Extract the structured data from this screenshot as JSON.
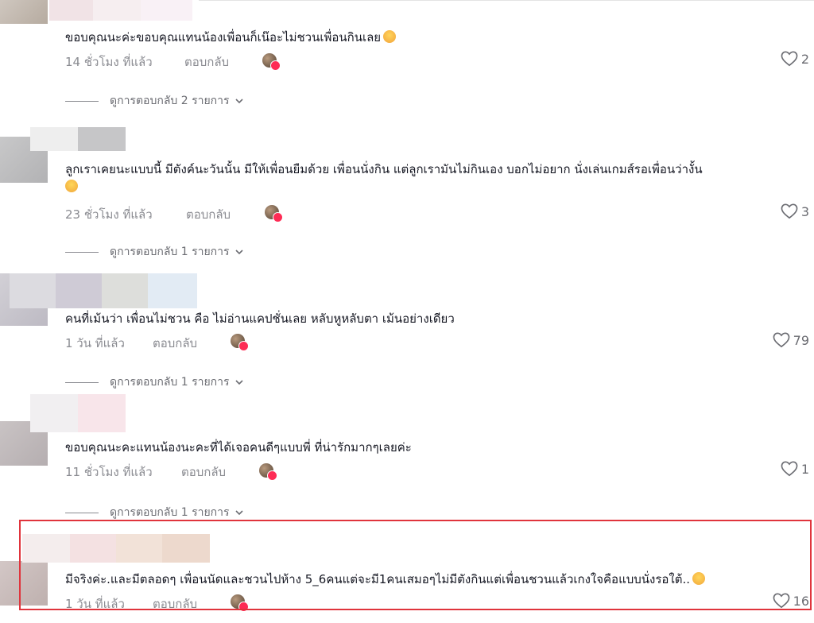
{
  "colors": {
    "accent": "#fe2c55",
    "highlight": "#e0343c",
    "muted": "#8a8b91"
  },
  "comments": [
    {
      "text": "ขอบคุณนะค่ะขอบคุณแทนน้องเพื่อนก็เน๊อะไม่ชวนเพื่อนกินเลย",
      "emoji": "weary-face",
      "time": "14 ชั่วโมง ที่แล้ว",
      "reply": "ตอบกลับ",
      "likes": "2",
      "view_replies": "ดูการตอบกลับ 2 รายการ"
    },
    {
      "text": "ลูกเราเคยนะแบบนี้ มีตังค์นะวันนั้น มีให้เพื่อนยืมด้วย เพื่อนนั่งกิน แต่ลูกเรามันไม่กินเอง บอกไม่อยาก นั่งเล่นเกมส์รอเพื่อนว่างั้น",
      "emoji": "grinning-sweat-face",
      "time": "23 ชั่วโมง ที่แล้ว",
      "reply": "ตอบกลับ",
      "likes": "3",
      "view_replies": "ดูการตอบกลับ 1 รายการ"
    },
    {
      "text": "คนที่เม้นว่า เพื่อนไม่ชวน คือ ไม่อ่านแคปชั่นเลย หลับหูหลับตา เม้นอย่างเดียว",
      "emoji": "",
      "time": "1 วัน ที่แล้ว",
      "reply": "ตอบกลับ",
      "likes": "79",
      "view_replies": "ดูการตอบกลับ 1 รายการ"
    },
    {
      "text": "ขอบคุณนะคะแทนน้องนะคะที่ได้เจอคนดีๆแบบพี่ ที่น่ารักมากๆเลยค่ะ",
      "emoji": "",
      "time": "11 ชั่วโมง ที่แล้ว",
      "reply": "ตอบกลับ",
      "likes": "1",
      "view_replies": "ดูการตอบกลับ 1 รายการ"
    },
    {
      "text": "มีจริงค่ะ.และมีตลอดๆ เพื่อนนัดและชวนไปห้าง 5_6คนแต่จะมี1คนเสมอๆไม่มีตังกินแต่เพื่อนชวนแล้วเกงใจคือแบบนั่งรอใต้..",
      "emoji": "pensive-face",
      "time": "1 วัน ที่แล้ว",
      "reply": "ตอบกลับ",
      "likes": "16",
      "view_replies": ""
    }
  ]
}
